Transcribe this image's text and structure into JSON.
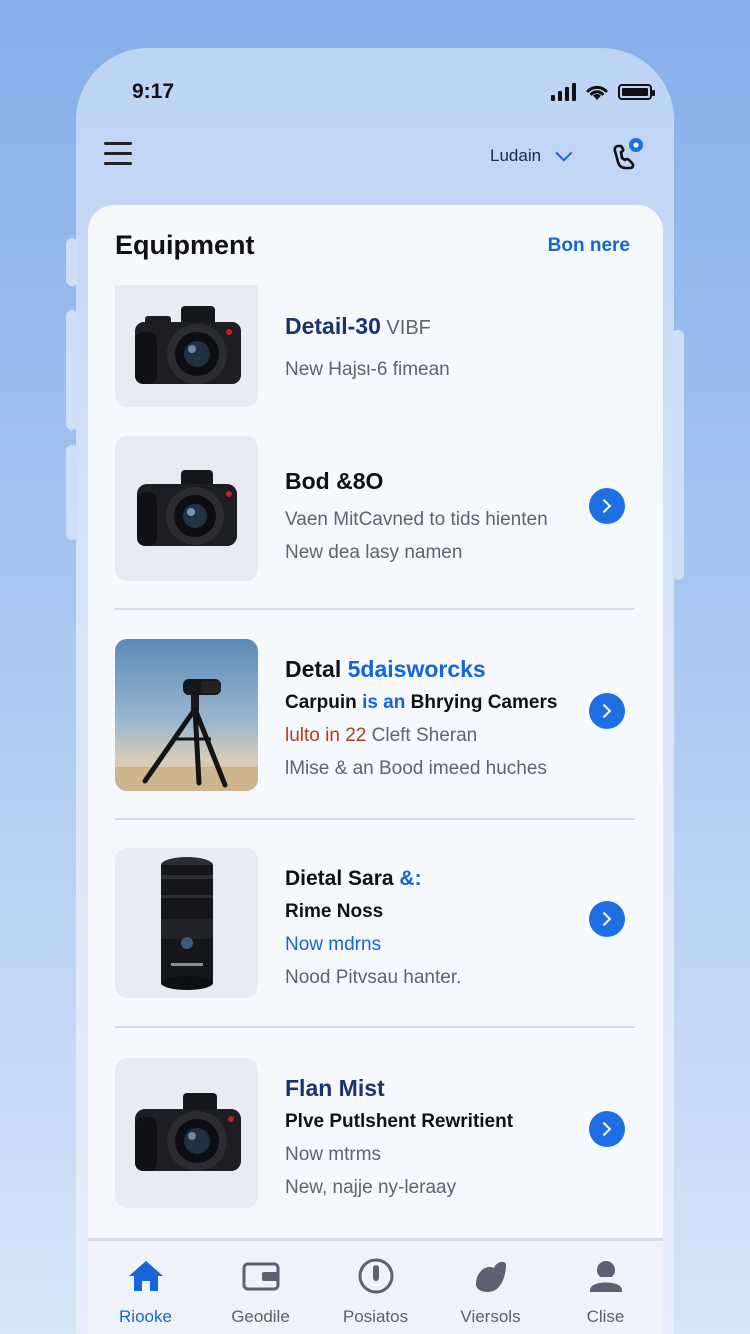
{
  "status_bar": {
    "time": "9:17"
  },
  "header": {
    "account_name": "Ludain"
  },
  "card": {
    "title": "Equipment",
    "link": "Bon nere"
  },
  "items": [
    {
      "lines": [
        {
          "a": "Detail-30",
          "b": " VIBF"
        },
        {
          "a": "New Ηajsι-6 fimean"
        }
      ]
    },
    {
      "lines": [
        {
          "a": "Bod &8O"
        },
        {
          "a": "Vaen MitCavned to tids hienten"
        },
        {
          "a": "New dea lasy namen"
        }
      ]
    },
    {
      "lines": [
        {
          "a": "Detal ",
          "b": "5daisworcks"
        },
        {
          "a": "Carpuin ",
          "b": "is an",
          "c": " Bhrying Camers"
        },
        {
          "a": "lulto in 22",
          "b": " Cleft Sheran"
        },
        {
          "a": "lMise & an Bood imeed huches"
        }
      ]
    },
    {
      "lines": [
        {
          "a": "Dietal Sara",
          "b": " &:"
        },
        {
          "a": "Rime Noss"
        },
        {
          "a": "Now mdrns"
        },
        {
          "a": "Nood Pitvsau hanter."
        }
      ]
    },
    {
      "lines": [
        {
          "a": "Flan Mist"
        },
        {
          "a": "Plve Putlshent Rewritient"
        },
        {
          "a": "Now mtrms"
        },
        {
          "a": "New, najje ny-leraay"
        }
      ]
    }
  ],
  "tabs": [
    {
      "label": "Riooke",
      "icon": "home-icon",
      "active": true
    },
    {
      "label": "Geodile",
      "icon": "wallet-icon"
    },
    {
      "label": "Posiatos",
      "icon": "compass-icon"
    },
    {
      "label": "Viersols",
      "icon": "leaf-icon"
    },
    {
      "label": "Clise",
      "icon": "user-icon"
    }
  ],
  "colors": {
    "accent": "#1565d8",
    "arrow": "#1e6fe3",
    "background": "#a8c6f1"
  }
}
